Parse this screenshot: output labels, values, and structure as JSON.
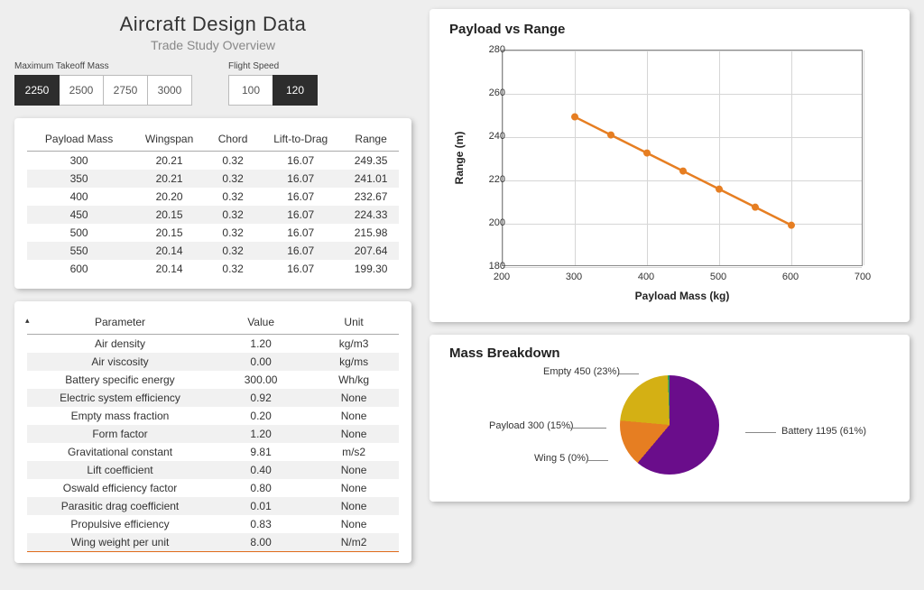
{
  "header": {
    "title": "Aircraft Design Data",
    "subtitle": "Trade Study Overview"
  },
  "controls": {
    "mtom": {
      "label": "Maximum Takeoff Mass",
      "options": [
        "2250",
        "2500",
        "2750",
        "3000"
      ],
      "selected": "2250"
    },
    "speed": {
      "label": "Flight Speed",
      "options": [
        "100",
        "120"
      ],
      "selected": "120"
    }
  },
  "table1": {
    "headers": [
      "Payload Mass",
      "Wingspan",
      "Chord",
      "Lift-to-Drag",
      "Range"
    ],
    "rows": [
      [
        "300",
        "20.21",
        "0.32",
        "16.07",
        "249.35"
      ],
      [
        "350",
        "20.21",
        "0.32",
        "16.07",
        "241.01"
      ],
      [
        "400",
        "20.20",
        "0.32",
        "16.07",
        "232.67"
      ],
      [
        "450",
        "20.15",
        "0.32",
        "16.07",
        "224.33"
      ],
      [
        "500",
        "20.15",
        "0.32",
        "16.07",
        "215.98"
      ],
      [
        "550",
        "20.14",
        "0.32",
        "16.07",
        "207.64"
      ],
      [
        "600",
        "20.14",
        "0.32",
        "16.07",
        "199.30"
      ]
    ]
  },
  "table2": {
    "headers": [
      "Parameter",
      "Value",
      "Unit"
    ],
    "rows": [
      [
        "Air density",
        "1.20",
        "kg/m3"
      ],
      [
        "Air viscosity",
        "0.00",
        "kg/ms"
      ],
      [
        "Battery specific energy",
        "300.00",
        "Wh/kg"
      ],
      [
        "Electric system efficiency",
        "0.92",
        "None"
      ],
      [
        "Empty mass fraction",
        "0.20",
        "None"
      ],
      [
        "Form factor",
        "1.20",
        "None"
      ],
      [
        "Gravitational constant",
        "9.81",
        "m/s2"
      ],
      [
        "Lift coefficient",
        "0.40",
        "None"
      ],
      [
        "Oswald efficiency factor",
        "0.80",
        "None"
      ],
      [
        "Parasitic drag coefficient",
        "0.01",
        "None"
      ],
      [
        "Propulsive efficiency",
        "0.83",
        "None"
      ],
      [
        "Wing weight per unit",
        "8.00",
        "N/m2"
      ]
    ]
  },
  "line_chart": {
    "title": "Payload vs Range",
    "xlabel": "Payload Mass (kg)",
    "ylabel": "Range (m)",
    "xticks": [
      200,
      300,
      400,
      500,
      600,
      700
    ],
    "yticks": [
      180,
      200,
      220,
      240,
      260,
      280
    ]
  },
  "pie_chart": {
    "title": "Mass Breakdown",
    "labels": {
      "battery": "Battery 1195 (61%)",
      "payload": "Payload 300 (15%)",
      "empty": "Empty 450 (23%)",
      "wing": "Wing 5 (0%)"
    }
  },
  "chart_data": [
    {
      "type": "line",
      "title": "Payload vs Range",
      "xlabel": "Payload Mass (kg)",
      "ylabel": "Range (m)",
      "xlim": [
        200,
        700
      ],
      "ylim": [
        180,
        280
      ],
      "x": [
        300,
        350,
        400,
        450,
        500,
        550,
        600
      ],
      "y": [
        249.35,
        241.01,
        232.67,
        224.33,
        215.98,
        207.64,
        199.3
      ],
      "series_name": "Range"
    },
    {
      "type": "pie",
      "title": "Mass Breakdown",
      "categories": [
        "Battery",
        "Payload",
        "Empty",
        "Wing"
      ],
      "values": [
        1195,
        300,
        450,
        5
      ],
      "percentages": [
        61,
        15,
        23,
        0
      ]
    }
  ]
}
